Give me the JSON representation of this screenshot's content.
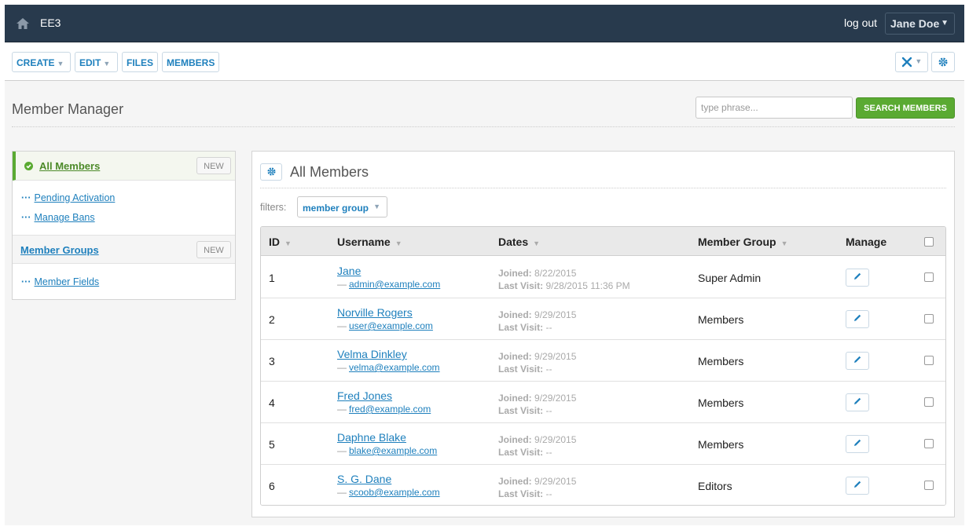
{
  "topbar": {
    "site_name": "EE3",
    "logout": "log out",
    "user": "Jane Doe"
  },
  "nav": {
    "create": "CREATE",
    "edit": "EDIT",
    "files": "FILES",
    "members": "MEMBERS"
  },
  "page": {
    "title": "Member Manager",
    "search_placeholder": "type phrase...",
    "search_button": "SEARCH MEMBERS"
  },
  "sidebar": {
    "all_members": "All Members",
    "new_label": "NEW",
    "pending": "Pending Activation",
    "bans": "Manage Bans",
    "groups": "Member Groups",
    "fields": "Member Fields"
  },
  "panel": {
    "title": "All Members",
    "filters_label": "filters:",
    "filter_button": "member group"
  },
  "table": {
    "headers": {
      "id": "ID",
      "username": "Username",
      "dates": "Dates",
      "group": "Member Group",
      "manage": "Manage"
    },
    "joined_label": "Joined:",
    "last_visit_label": "Last Visit:",
    "rows": [
      {
        "id": "1",
        "username": "Jane",
        "email": "admin@example.com",
        "joined": "8/22/2015",
        "last_visit": "9/28/2015 11:36 PM",
        "group": "Super Admin"
      },
      {
        "id": "2",
        "username": "Norville Rogers",
        "email": "user@example.com",
        "joined": "9/29/2015",
        "last_visit": "--",
        "group": "Members"
      },
      {
        "id": "3",
        "username": "Velma Dinkley",
        "email": "velma@example.com",
        "joined": "9/29/2015",
        "last_visit": "--",
        "group": "Members"
      },
      {
        "id": "4",
        "username": "Fred Jones",
        "email": "fred@example.com",
        "joined": "9/29/2015",
        "last_visit": "--",
        "group": "Members"
      },
      {
        "id": "5",
        "username": "Daphne Blake",
        "email": "blake@example.com",
        "joined": "9/29/2015",
        "last_visit": "--",
        "group": "Members"
      },
      {
        "id": "6",
        "username": "S. G. Dane",
        "email": "scoob@example.com",
        "joined": "9/29/2015",
        "last_visit": "--",
        "group": "Editors"
      }
    ]
  },
  "icons": {
    "home": "home-icon",
    "chevron": "chevron-down-icon",
    "tools": "tools-icon",
    "gear": "gear-icon",
    "check": "check-circle-icon",
    "edit": "pencil-icon",
    "sort": "sort-icon"
  },
  "colors": {
    "topbar": "#283a4d",
    "link": "#1f80bd",
    "accent_green": "#5aaa32"
  }
}
